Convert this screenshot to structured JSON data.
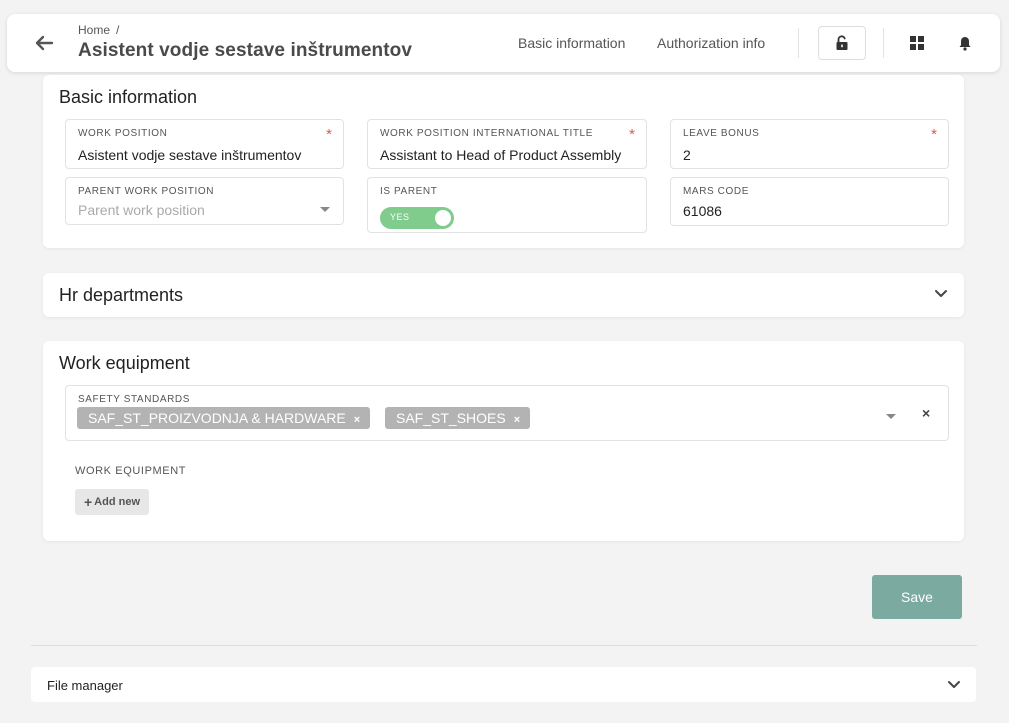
{
  "header": {
    "breadcrumb_home": "Home",
    "breadcrumb_sep": "/",
    "title": "Asistent vodje sestave inštrumentov",
    "nav_basic": "Basic information",
    "nav_auth": "Authorization info",
    "icons": [
      "arrow-left-icon",
      "unlock-icon",
      "grid-icon",
      "bell-icon"
    ]
  },
  "basic": {
    "title": "Basic information",
    "work_position": {
      "label": "WORK POSITION",
      "value": "Asistent vodje sestave inštrumentov",
      "required": "*"
    },
    "intl_title": {
      "label": "WORK POSITION INTERNATIONAL TITLE",
      "value": "Assistant to Head of Product Assembly",
      "required": "*"
    },
    "leave_bonus": {
      "label": "LEAVE BONUS",
      "value": "2",
      "required": "*"
    },
    "parent": {
      "label": "PARENT WORK POSITION",
      "placeholder": "Parent work position"
    },
    "is_parent": {
      "label": "IS PARENT",
      "toggle_text": "YES"
    },
    "mars_code": {
      "label": "MARS CODE",
      "value": "61086"
    }
  },
  "hr": {
    "title": "Hr departments"
  },
  "equipment": {
    "title": "Work equipment",
    "safety_label": "SAFETY STANDARDS",
    "chips": [
      "SAF_ST_PROIZVODNJA & HARDWARE",
      "SAF_ST_SHOES"
    ],
    "chip_remove": "×",
    "clear": "×",
    "work_equipment_label": "WORK EQUIPMENT",
    "add_new": "Add new",
    "add_plus": "+"
  },
  "actions": {
    "save": "Save"
  },
  "file_manager": {
    "label": "File manager"
  },
  "colors": {
    "accent": "#7baaa0",
    "toggle": "#80cc8c",
    "required": "#e05656",
    "chip": "#b3b3b3"
  }
}
